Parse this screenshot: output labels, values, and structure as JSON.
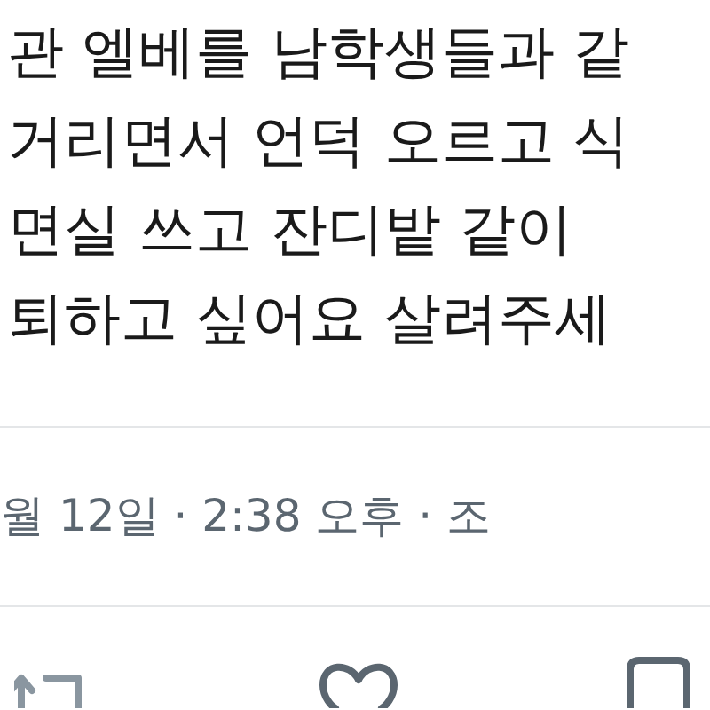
{
  "tweet": {
    "lines": [
      "관 엘베를 남학생들과 같",
      "거리면서 언덕 오르고 식",
      "면실 쓰고 잔디밭 같이",
      "퇴하고 싶어요 살려주세"
    ],
    "meta": "월 12일 · 2:38 오후 · 조"
  }
}
